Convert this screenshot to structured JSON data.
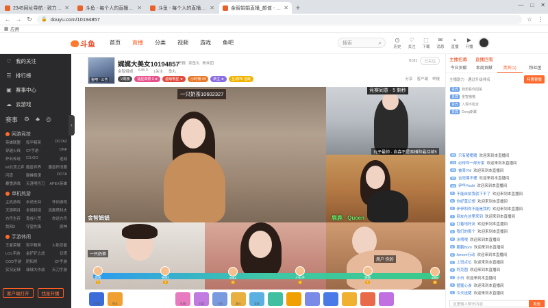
{
  "browser": {
    "tabs": [
      {
        "title": "2345网址导航 - 致力于打造百年品牌",
        "active": false
      },
      {
        "title": "斗鱼 - 每个人的直播平台",
        "active": false
      },
      {
        "title": "斗鱼 - 每个人的直播平台",
        "active": false
      },
      {
        "title": "金智娟娟直播_颜值 - 斗鱼直播",
        "active": true
      }
    ],
    "url": "douyu.com/10194857",
    "bookmark": "应用"
  },
  "site": {
    "logo_text": "斗鱼",
    "nav": [
      {
        "label": "首页",
        "active": false
      },
      {
        "label": "直播",
        "active": true
      },
      {
        "label": "分类",
        "active": false
      },
      {
        "label": "视频",
        "active": false
      },
      {
        "label": "游戏",
        "active": false
      },
      {
        "label": "鱼吧",
        "active": false
      }
    ],
    "search_placeholder": "搜索",
    "header_icons": [
      {
        "icon": "history-icon",
        "label": "历史"
      },
      {
        "icon": "heart-icon",
        "label": "关注"
      },
      {
        "icon": "gift-icon",
        "label": "下载"
      },
      {
        "icon": "message-icon",
        "label": "消息"
      },
      {
        "icon": "location-icon",
        "label": "直播"
      },
      {
        "icon": "play-icon",
        "label": "开播"
      }
    ]
  },
  "sidebar": {
    "items": [
      {
        "icon": "heart-icon",
        "label": "我的关注"
      },
      {
        "icon": "list-icon",
        "label": "排行榜"
      },
      {
        "icon": "box-icon",
        "label": "赛事中心"
      },
      {
        "icon": "cloud-icon",
        "label": "云游戏"
      }
    ],
    "quick_icons": [
      "赛事",
      "⚙",
      "♣",
      "◎"
    ],
    "sections": [
      {
        "title": "网游竞技",
        "games": [
          "英雄联盟",
          "和平精英",
          "DOTA2",
          "穿越火线",
          "CF手游",
          "DNF",
          "炉石传说",
          "CS:GO",
          "逆战",
          "lol云顶之弈",
          "魔兽世界",
          "魔兽怀旧服",
          "问道",
          "巅峰极速",
          "DOTA",
          "暴雪游戏",
          "天涯明月刀",
          "APEX英雄"
        ]
      },
      {
        "title": "单机热游",
        "games": [
          "主机游戏",
          "永劫无间",
          "怀旧游戏",
          "天涯明月",
          "全境封锁",
          "逃离塔科夫",
          "方舟生存",
          "鬼谷八荒",
          "命运方舟",
          "剑网3",
          "守望先锋",
          "原神"
        ]
      },
      {
        "title": "手游休闲",
        "games": [
          "王者荣耀",
          "和平精英",
          "火影忍者",
          "LOL手游",
          "金铲铲之战",
          "幻塔",
          "COD手游",
          "阴阳师",
          "CF手游",
          "实况足球",
          "球球大作战",
          "天刀手游"
        ]
      }
    ],
    "buttons": [
      "客户端打开",
      "找星开播"
    ]
  },
  "room": {
    "thumb_label": "鱼吧 · 公告",
    "title": "娓娓大美女10194857",
    "links": [
      "举报",
      "卖鱼丸",
      "粉丝团"
    ],
    "meta": [
      "金智娟娟",
      "548.0",
      "1关注",
      "鱼丸"
    ],
    "badges": [
      {
        "label": "V周榜",
        "color": "#4a4a4a"
      },
      {
        "label": "福星高照 3 ★",
        "color": "#e8508c"
      },
      {
        "label": "超级明星 ★",
        "color": "#e04a3c"
      },
      {
        "label": "小时榜 44",
        "color": "#e87a2a"
      },
      {
        "label": "新主 ★",
        "color": "#8a6ce0"
      },
      {
        "label": "互动PK 活跃",
        "color": "#f0b500"
      }
    ],
    "viewer_count": "8181",
    "follow_label": "已关注",
    "actions": [
      "分享",
      "客户端",
      "举报"
    ]
  },
  "video": {
    "box_number": "一只奶茶10602327",
    "main_tag": "金智娟娟",
    "tr_caption": "丸子最帅 · 自森不是蛮横和最持续5",
    "tr_timer": "竞赛同意 · 5 剩秒",
    "mr_tag": "鹿鹿 · Queen",
    "b1_text": "一只奶茶",
    "b3_text": "用户 你的",
    "votes": [
      {
        "name": "娓娓",
        "num": "1"
      },
      {
        "name": "丽丽2",
        "num": "2"
      },
      {
        "name": "2894",
        "num": "3"
      },
      {
        "name": "小丸子",
        "num": "4"
      },
      {
        "name": "丽丽",
        "num": "5"
      },
      {
        "name": "2000",
        "num": "6"
      }
    ],
    "vote_progress": 0.5
  },
  "gifts": [
    {
      "label": "PK吧",
      "color": "#3b6cd9"
    },
    {
      "label": "鱼丸",
      "color": "#f0a030"
    },
    {
      "label": "",
      "color": "#ffffff"
    },
    {
      "label": "礼物",
      "color": "#e87ac0"
    },
    {
      "label": "火箭",
      "color": "#c07ae0"
    },
    {
      "label": "飞机",
      "color": "#7a9ae0"
    },
    {
      "label": "超火",
      "color": "#e8b040"
    },
    {
      "label": "宝船",
      "color": "#5ab0e0"
    },
    {
      "label": "",
      "color": "#40c0a0"
    },
    {
      "label": "",
      "color": "#f0a000"
    },
    {
      "label": "",
      "color": "#7a8ae8"
    },
    {
      "label": "",
      "color": "#4a7ae8"
    },
    {
      "label": "",
      "color": "#f0b030"
    },
    {
      "label": "",
      "color": "#e86a4a"
    },
    {
      "label": "",
      "color": "#c070e0"
    }
  ],
  "right": {
    "top": [
      "主播招募",
      "直播回看"
    ],
    "tabs": [
      {
        "label": "今日贡献",
        "active": false
      },
      {
        "label": "本周贡献",
        "active": false
      },
      {
        "label": "贵宾(1)",
        "active": true
      },
      {
        "label": "粉丝团",
        "active": false
      }
    ],
    "rank_head": "主播助力 · 通过升级排名",
    "promo_btn": "特惠套餐",
    "ranks": [
      {
        "tag": "贵宾",
        "name": "我想看你回答"
      },
      {
        "tag": "贵宾",
        "name": "金智猪猪"
      },
      {
        "tag": "贵宾",
        "name": "入观不稳定"
      },
      {
        "tag": "贵宾",
        "name": "Dong斯翼"
      }
    ],
    "chat": [
      {
        "lv": "20",
        "nick": "只有猪猪猪",
        "msg": "欢迎来到本直播间"
      },
      {
        "lv": "19",
        "nick": "必得命一部分家",
        "msg": "欢迎来到本直播间"
      },
      {
        "lv": "15",
        "nick": "被某YM",
        "msg": "欢迎来到本直播间"
      },
      {
        "lv": "12",
        "nick": "吉冠爆不理",
        "msg": "欢迎来到本直播间"
      },
      {
        "lv": "10",
        "nick": "伊华Yoshi",
        "msg": "欢迎来到本直播间"
      },
      {
        "lv": "9",
        "nick": "不能自拍我就下不了",
        "msg": "欢迎来到本直播间"
      },
      {
        "lv": "8",
        "nick": "你好莫幻想",
        "msg": "欢迎来到本直播间"
      },
      {
        "lv": "8",
        "nick": "伊伊和你不能是我的",
        "msg": "欢迎来到本直播间"
      },
      {
        "lv": "7",
        "nick": "网友在这里来到",
        "msg": "欢迎来到本直播间"
      },
      {
        "lv": "7",
        "nick": "打着地好友",
        "msg": "欢迎来到本直播间"
      },
      {
        "lv": "6",
        "nick": "我们的那个",
        "msg": "欢迎来到本直播间"
      },
      {
        "lv": "6",
        "nick": "水喂喂",
        "msg": "欢迎来到本直播间"
      },
      {
        "lv": "5",
        "nick": "鹏鹏Bom",
        "msg": "欢迎来到本直播间"
      },
      {
        "lv": "5",
        "nick": "Amom行动",
        "msg": "欢迎来到本直播间"
      },
      {
        "lv": "4",
        "nick": "上班点位",
        "msg": "欢迎来到本直播间"
      },
      {
        "lv": "4",
        "nick": "阿克图",
        "msg": "欢迎来到本直播间"
      },
      {
        "lv": "3",
        "nick": "小白",
        "msg": "欢迎来到本直播间"
      },
      {
        "lv": "3",
        "nick": "猛猛心诶",
        "msg": "欢迎来到本直播间"
      },
      {
        "lv": "2",
        "nick": "今天送猪",
        "msg": "欢迎来到本直播间"
      }
    ],
    "input_placeholder": "这里输入聊天内容",
    "send_label": "发送"
  }
}
